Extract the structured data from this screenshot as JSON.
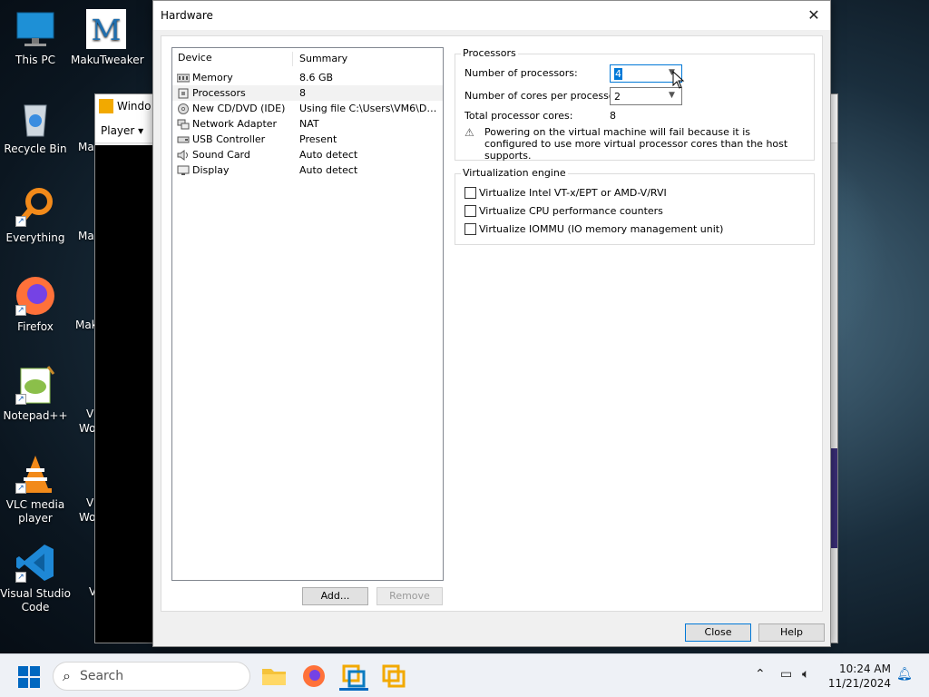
{
  "desktop": {
    "icons": [
      {
        "label": "This PC"
      },
      {
        "label": "MakuTweaker"
      },
      {
        "label": "Recycle Bin"
      },
      {
        "label": "Everything"
      },
      {
        "label": "Firefox"
      },
      {
        "label": "Notepad++"
      },
      {
        "label": "VLC media player"
      },
      {
        "label": "Visual Studio Code"
      }
    ],
    "partial_labels": [
      "Ma",
      "Mak",
      "Mak",
      "Vl",
      "Wo",
      "Vl",
      "Wo",
      "V"
    ]
  },
  "bg_window": {
    "title": "Windo",
    "menu_player": "Player"
  },
  "dialog": {
    "title": "Hardware",
    "device_list": {
      "columns": [
        "Device",
        "Summary"
      ],
      "rows": [
        {
          "device": "Memory",
          "summary": "8.6 GB",
          "icon": "memory-icon"
        },
        {
          "device": "Processors",
          "summary": "8",
          "icon": "processor-icon",
          "selected": true
        },
        {
          "device": "New CD/DVD (IDE)",
          "summary": "Using file C:\\Users\\VM6\\Dow...",
          "icon": "cd-icon"
        },
        {
          "device": "Network Adapter",
          "summary": "NAT",
          "icon": "network-icon"
        },
        {
          "device": "USB Controller",
          "summary": "Present",
          "icon": "usb-icon"
        },
        {
          "device": "Sound Card",
          "summary": "Auto detect",
          "icon": "speaker-icon"
        },
        {
          "device": "Display",
          "summary": "Auto detect",
          "icon": "monitor-icon"
        }
      ]
    },
    "add_button": "Add...",
    "remove_button": "Remove",
    "processors": {
      "title": "Processors",
      "num_processors_label": "Number of processors:",
      "num_processors_value": "4",
      "cores_label": "Number of cores per processor:",
      "cores_value": "2",
      "total_label": "Total processor cores:",
      "total_value": "8",
      "warning": "Powering on the virtual machine will fail because it is configured to use more virtual processor cores than the host supports."
    },
    "virtualization": {
      "title": "Virtualization engine",
      "options": [
        {
          "label": "Virtualize Intel VT-x/EPT or AMD-V/RVI",
          "checked": false
        },
        {
          "label": "Virtualize CPU performance counters",
          "checked": false
        },
        {
          "label": "Virtualize IOMMU (IO memory management unit)",
          "checked": false
        }
      ]
    },
    "close_button": "Close",
    "help_button": "Help"
  },
  "taskbar": {
    "search_placeholder": "Search",
    "time": "10:24 AM",
    "date": "11/21/2024"
  },
  "colors": {
    "accent": "#0078d7",
    "start_blue": "#0067c0"
  }
}
